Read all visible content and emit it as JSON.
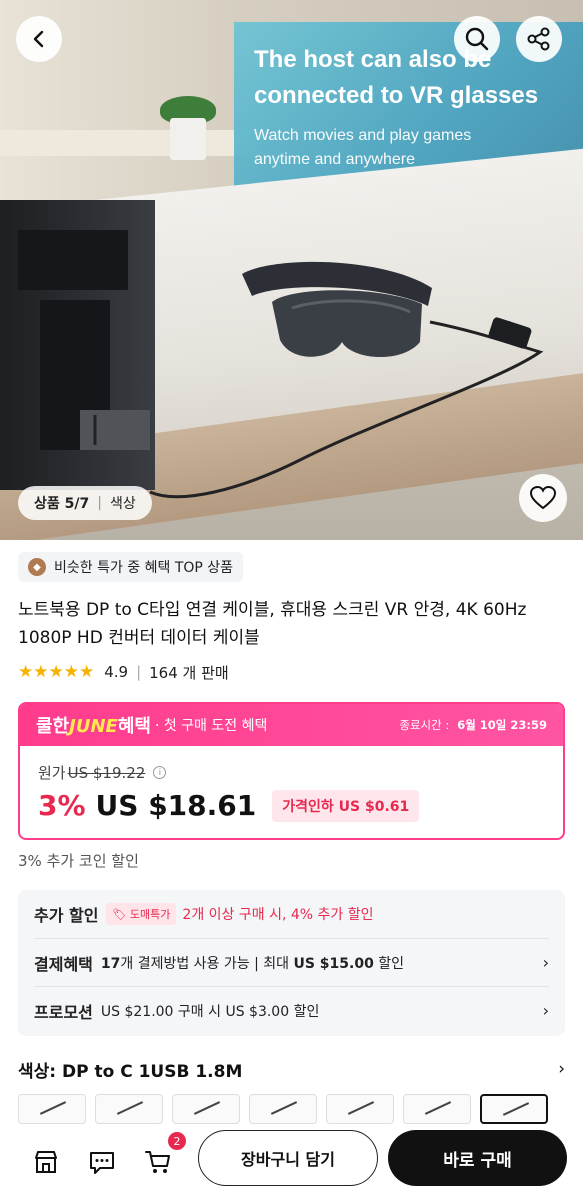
{
  "hero": {
    "headline_line1": "The host can also be",
    "headline_line2": "connected to VR glasses",
    "subtitle_line1": "Watch movies and play games",
    "subtitle_line2": "anytime and anywhere",
    "counter_label": "상품 5/7",
    "counter_sep": "|",
    "counter_tab": "색상"
  },
  "badge": {
    "text": "비슷한 특가 중 혜택 TOP 상품"
  },
  "product": {
    "title": "노트북용 DP to C타입 연결 케이블, 휴대용 스크린 VR 안경, 4K 60Hz 1080P HD 컨버터 데이터 케이블",
    "stars": "★★★★★",
    "rating": "4.9",
    "rating_sep": "|",
    "sold": "164 개 판매"
  },
  "promo": {
    "brand_prefix": "쿨한",
    "brand_june": "JUNE",
    "brand_suffix": "혜택",
    "subtitle": "· 첫 구매 도전 혜택",
    "end_label": "종료시간 :",
    "end_time": "6월 10일 23:59",
    "orig_label": "원가",
    "orig_price": "US $19.22",
    "discount": "3%",
    "price": "US $18.61",
    "reduce_tag": "가격인하 US $0.61"
  },
  "coin_line": "3% 추가 코인 할인",
  "benefits": {
    "extra_label": "추가 할인",
    "wholesale_tag": "도매특가",
    "extra_text": "2개 이상 구매 시, 4% 추가 할인",
    "payment_label": "결제혜택",
    "payment_count": "17",
    "payment_text_a": "개 결제방법 사용 가능 | 최대 ",
    "payment_max": "US $15.00",
    "payment_text_b": " 할인",
    "promo_label": "프로모션",
    "promo_text": "US $21.00 구매 시 US $3.00 할인"
  },
  "color": {
    "label": "색상: DP to C 1USB 1.8M"
  },
  "bottom": {
    "cart_count": "2",
    "cart_button": "장바구니 담기",
    "buy_button": "바로 구매"
  },
  "icons": {
    "back": "chevron-left-icon",
    "search": "search-icon",
    "share": "share-icon",
    "heart": "heart-icon",
    "store": "store-icon",
    "message": "message-icon",
    "cart": "cart-icon"
  },
  "colors": {
    "accent_pink": "#ff3d8b",
    "discount_red": "#e8294f",
    "june_yellow": "#ffe94d",
    "star": "#f5b301"
  }
}
